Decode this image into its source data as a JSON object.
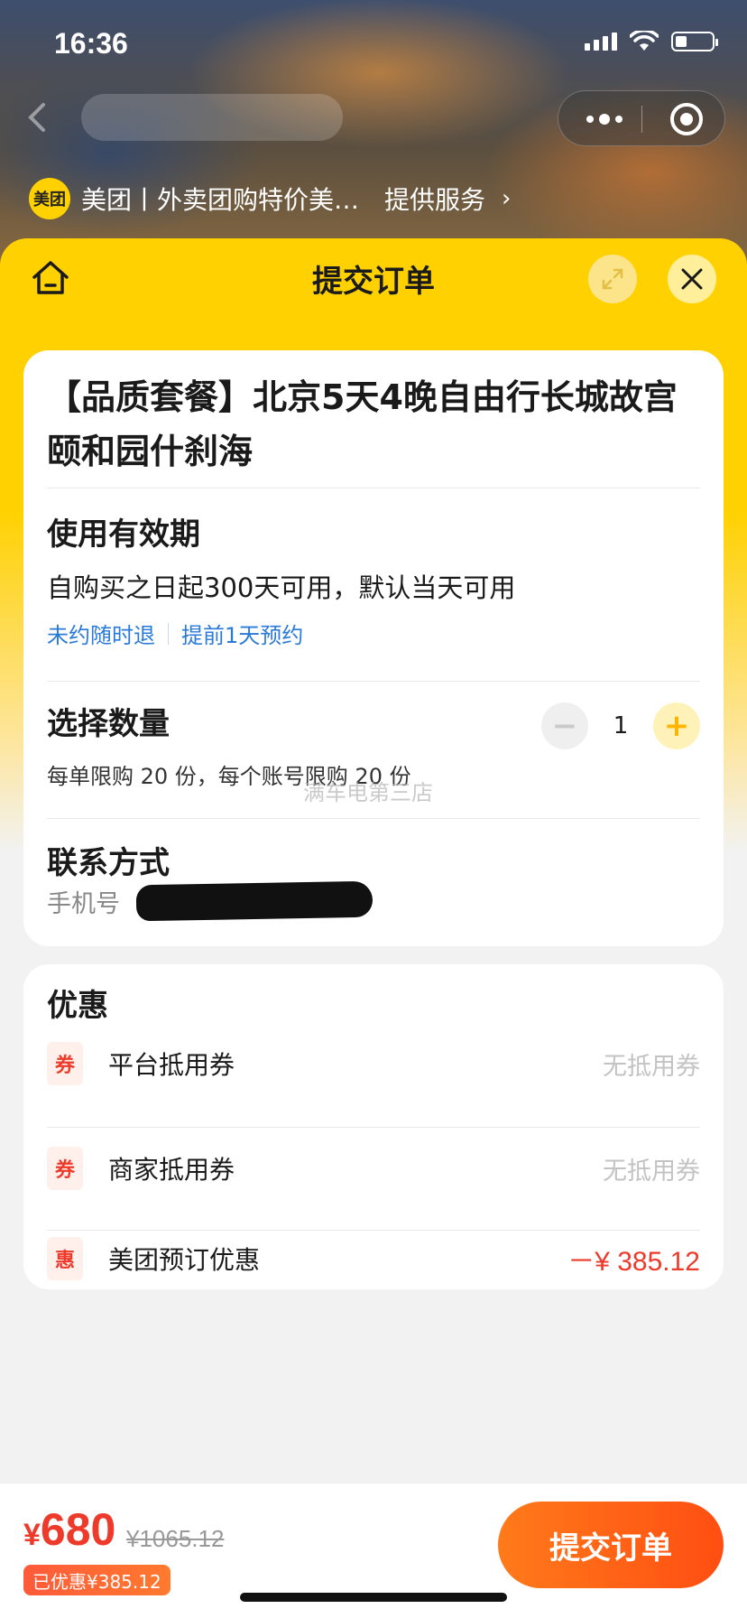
{
  "status_bar": {
    "time": "16:36"
  },
  "provider": {
    "logo_text": "美团",
    "name": "美团丨外卖团购特价美…",
    "service_label": "提供服务",
    "chevron": "›"
  },
  "sheet": {
    "title": "提交订单"
  },
  "product": {
    "title": "【品质套餐】北京5天4晚自由行长城故宫颐和园什刹海"
  },
  "validity": {
    "label": "使用有效期",
    "text": "自购买之日起300天可用，默认当天可用",
    "tags": [
      "未约随时退",
      "提前1天预约"
    ]
  },
  "quantity": {
    "label": "选择数量",
    "minus": "−",
    "value": "1",
    "plus": "+",
    "limit_text": "每单限购 20 份，每个账号限购 20 份",
    "watermark": "满车电第三店"
  },
  "contact": {
    "label": "联系方式",
    "phone_label": "手机号"
  },
  "discounts": {
    "label": "优惠",
    "rows": [
      {
        "badge": "券",
        "label": "平台抵用券",
        "value": "无抵用券"
      },
      {
        "badge": "券",
        "label": "商家抵用券",
        "value": "无抵用券"
      },
      {
        "badge": "惠",
        "label": "美团预订优惠",
        "value": "－¥ 385.12"
      }
    ]
  },
  "bottom": {
    "currency": "¥",
    "price": "680",
    "original_price": "¥1065.12",
    "saved_text": "已优惠¥385.12",
    "submit_label": "提交订单"
  },
  "colors": {
    "brand_yellow": "#ffd100",
    "price_red": "#ee3a2b",
    "link_blue": "#2a7ad8",
    "submit_orange": "#ff5a14"
  }
}
